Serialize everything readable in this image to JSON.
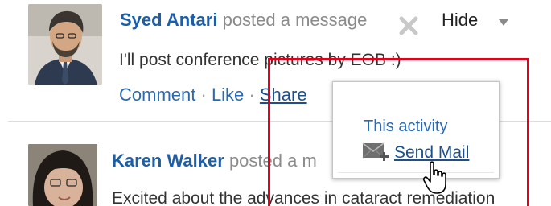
{
  "posts": [
    {
      "author": "Syed Antari",
      "action": "posted a message",
      "message": "I'll post conference pictures by EOB :)",
      "actions": {
        "comment": "Comment",
        "like": "Like",
        "share": "Share",
        "separator": "·"
      },
      "hide_label": "Hide"
    },
    {
      "author": "Karen Walker",
      "action": "posted a m",
      "message": "Excited about the advances in cataract remediation"
    }
  ],
  "popup": {
    "title": "This activity",
    "send_mail_label": "Send Mail"
  },
  "icons": {
    "close": "close-icon",
    "hide_menu": "chevron-down-icon",
    "mail": "mail-add-icon",
    "cursor": "hand-pointer-cursor"
  },
  "colors": {
    "link": "#1d5ea8",
    "highlight": "#e2001a"
  }
}
